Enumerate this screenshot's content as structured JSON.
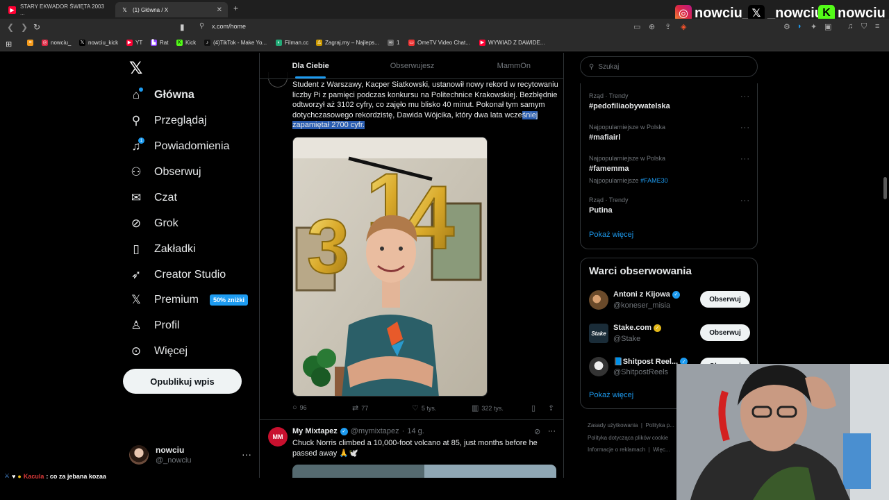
{
  "browser": {
    "tabs": [
      {
        "title": "STARY EKWADOR ŚWIĘTA 2003 ...",
        "favicon": "youtube-icon"
      },
      {
        "title": "(1) Główna / X",
        "favicon": "x-icon"
      }
    ],
    "url": "x.com/home",
    "bookmarks": [
      {
        "label": "nowciu_",
        "icon": "instagram-icon"
      },
      {
        "label": "nowciu_kick",
        "icon": "x-icon"
      },
      {
        "label": "YT",
        "icon": "youtube-icon"
      },
      {
        "label": "Rat",
        "icon": "twitch-icon"
      },
      {
        "label": "Kick",
        "icon": "kick-icon"
      },
      {
        "label": "(4)TikTok - Make Yo...",
        "icon": "tiktok-icon"
      },
      {
        "label": "Filman.cc",
        "icon": "filman-icon"
      },
      {
        "label": "Zagraj.my – Najleps...",
        "icon": "zagraj-icon"
      },
      {
        "label": "1",
        "icon": "link-icon"
      },
      {
        "label": "OmeTV Video Chat...",
        "icon": "ometv-icon"
      },
      {
        "label": "WYWIAD Z DAWIDE...",
        "icon": "youtube-icon"
      }
    ]
  },
  "stream_overlay": {
    "handles": [
      "nowciu_",
      "_nowciu",
      "nowciu"
    ]
  },
  "sidebar": {
    "items": [
      {
        "label": "Główna",
        "icon": "home-icon",
        "active": true
      },
      {
        "label": "Przeglądaj",
        "icon": "search-icon"
      },
      {
        "label": "Powiadomienia",
        "icon": "bell-icon",
        "badge": "1"
      },
      {
        "label": "Obserwuj",
        "icon": "follow-icon"
      },
      {
        "label": "Czat",
        "icon": "mail-icon"
      },
      {
        "label": "Grok",
        "icon": "grok-icon"
      },
      {
        "label": "Zakładki",
        "icon": "bookmark-icon"
      },
      {
        "label": "Creator Studio",
        "icon": "rocket-icon"
      },
      {
        "label": "Premium",
        "icon": "x-icon",
        "badge": "50% zniżki"
      },
      {
        "label": "Profil",
        "icon": "person-icon"
      },
      {
        "label": "Więcej",
        "icon": "more-circle-icon"
      }
    ],
    "post_button": "Opublikuj wpis",
    "account": {
      "name": "nowciu",
      "handle": "@_nowciu"
    }
  },
  "feed": {
    "tabs": [
      "Dla Ciebie",
      "Obserwujesz",
      "MammOn"
    ],
    "post1": {
      "text_a": "Student z Warszawy, Kacper Siatkowski, ustanowił nowy rekord w recytowaniu liczby Pi z pamięci podczas konkursu na Politechnice Krakowskiej. Bezbłędnie odtworzył aż 3102 cyfry, co zajęło mu blisko 40 minut. Pokonał tym samym dotychczasowego rekordzistę, Dawida Wójcika, który dwa lata wcze",
      "text_highlighted": "śniej zapamiętał 2700 cyfr.",
      "balloons": "314",
      "stats": {
        "replies": "96",
        "reposts": "77",
        "likes": "5 tys.",
        "views": "322 tys."
      }
    },
    "post2": {
      "name": "My Mixtapez",
      "handle": "@mymixtapez",
      "time": "14 g.",
      "avatar_text": "MM",
      "text": "Chuck Norris climbed a 10,000-foot volcano at 85, just months before he passed away 🙏🕊️"
    }
  },
  "right": {
    "search_placeholder": "Szukaj",
    "trends": [
      {
        "category": "Rząd · Trendy",
        "title": "#pedofiliaobywatelska"
      },
      {
        "category": "Najpopularniejsze w Polska",
        "title": "#mafiairl"
      },
      {
        "category": "Najpopularniejsze w Polska",
        "title": "#famemma",
        "sub_label": "Najpopularniejsze",
        "sub_tag": "#FAME30"
      },
      {
        "category": "Rząd · Trendy",
        "title": "Putina"
      }
    ],
    "show_more": "Pokaż więcej",
    "who_to_follow_title": "Warci obserwowania",
    "who_to_follow": [
      {
        "name": "Antoni z Kijowa",
        "handle": "@koneser_misia",
        "button": "Obserwuj"
      },
      {
        "name": "Stake.com",
        "handle": "@Stake",
        "button": "Obserwuj",
        "avatar_text": "Stake"
      },
      {
        "name": "📘Shitpost Reel...",
        "handle": "@ShitpostReels",
        "button": "Obserwuj"
      }
    ],
    "show_more_2": "Pokaż więcej",
    "footer": [
      "Zasady użytkowania",
      "Polityka p...",
      "Polityka dotycząca plików cookie",
      "Informacje o reklamach",
      "Więc..."
    ]
  },
  "chat": {
    "user": "Kacula",
    "message": ": co za jebana kozaa"
  },
  "colors": {
    "accent": "#1d9bf0",
    "background": "#000000",
    "border": "#2f3336",
    "muted": "#71767b"
  }
}
